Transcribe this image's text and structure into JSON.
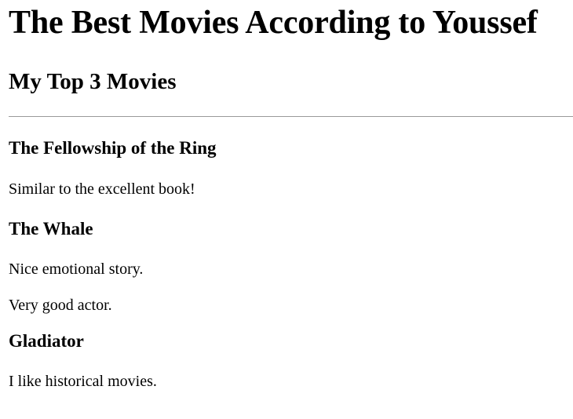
{
  "page": {
    "title": "The Best Movies According to Youssef",
    "subtitle": "My Top 3 Movies"
  },
  "movies": [
    {
      "title": "The Fellowship of the Ring",
      "notes": [
        "Similar to the excellent book!"
      ]
    },
    {
      "title": "The Whale",
      "notes": [
        "Nice emotional story.",
        "Very good actor."
      ]
    },
    {
      "title": "Gladiator",
      "notes": [
        "I like historical movies."
      ]
    }
  ]
}
